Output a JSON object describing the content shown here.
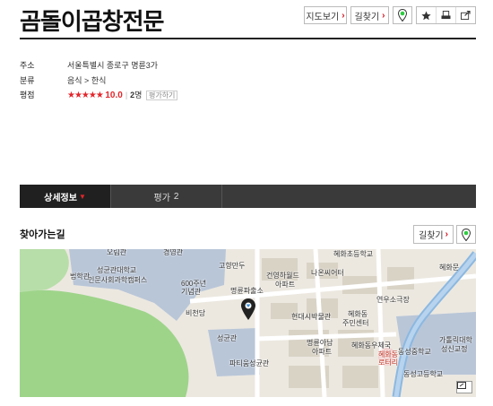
{
  "place": {
    "name": "곰돌이곱창전문"
  },
  "toolbar": {
    "map_view_label": "지도보기",
    "directions_label": "길찾기",
    "icons": [
      "pin-icon",
      "star-icon",
      "print-icon",
      "share-icon"
    ]
  },
  "info": {
    "address_key": "주소",
    "address_value": "서울특별시 종로구 명륜3가",
    "category_key": "분류",
    "category_value": "음식 > 한식",
    "rating_key": "평점",
    "stars": "★★★★★",
    "rating_value": "10.0",
    "review_count": "2",
    "review_unit": "명",
    "review_tag": "평가하기"
  },
  "tabs": [
    {
      "label": "상세정보",
      "active": true
    },
    {
      "label": "평가",
      "count": "2",
      "active": false
    }
  ],
  "directions_section": {
    "title": "찾아가는길",
    "directions_label": "길찾기"
  },
  "map": {
    "labels": {
      "a": "오림관",
      "b": "경영관",
      "c": "성균관대학교",
      "d": "인문사회과학캠퍼스",
      "e": "법학관",
      "f": "600주년",
      "g": "기념관",
      "h": "비천당",
      "i": "성균관",
      "j": "고향만두",
      "k": "명륜파출소",
      "l": "건영하월드",
      "m": "아파트",
      "n": "나온씨어터",
      "o": "혜화초등학교",
      "p": "연우소극장",
      "q": "혜화동",
      "r": "주민센터",
      "s": "현대시박물관",
      "t": "명륜아남",
      "u": "아파트",
      "v": "혜화동우체국",
      "w": "파티움성균관",
      "x": "혜화동",
      "y": "로터리",
      "z": "동성중학교",
      "aa": "동성고등학교",
      "ab": "가톨릭대학",
      "ac": "성신교정",
      "ad": "혜화문"
    }
  },
  "colors": {
    "accent": "#e3262b",
    "tab_bg": "#3a3a3a",
    "pin_green": "#2ecc40"
  }
}
